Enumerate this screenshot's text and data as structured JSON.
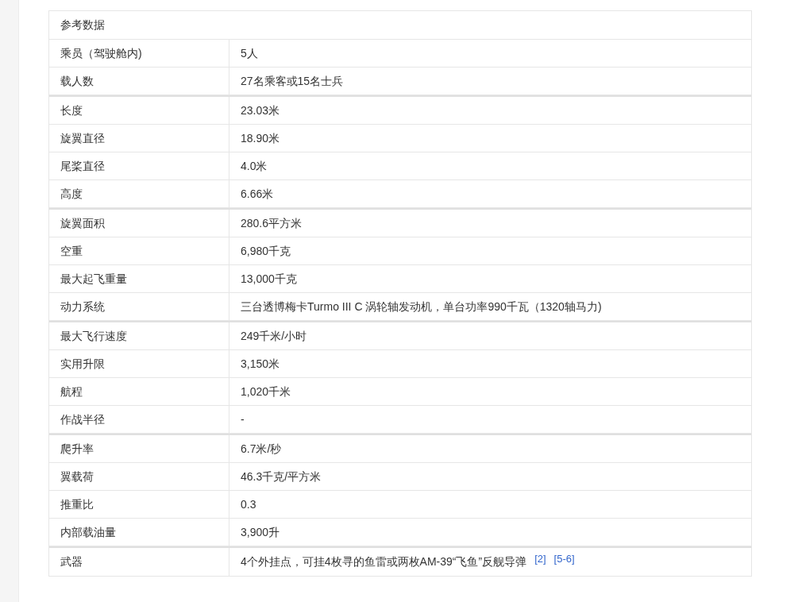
{
  "table": {
    "title": "参考数据",
    "rows": [
      {
        "label": "乘员（驾驶舱内)",
        "value": "5人",
        "section_start": false
      },
      {
        "label": "载人数",
        "value": "27名乘客或15名士兵",
        "section_start": false
      },
      {
        "label": "长度",
        "value": "23.03米",
        "section_start": true
      },
      {
        "label": "旋翼直径",
        "value": "18.90米",
        "section_start": false
      },
      {
        "label": "尾桨直径",
        "value": "4.0米",
        "section_start": false
      },
      {
        "label": "高度",
        "value": "6.66米",
        "section_start": false
      },
      {
        "label": "旋翼面积",
        "value": "280.6平方米",
        "section_start": true
      },
      {
        "label": "空重",
        "value": "6,980千克",
        "section_start": false
      },
      {
        "label": "最大起飞重量",
        "value": "13,000千克",
        "section_start": false
      },
      {
        "label": "动力系统",
        "value": "三台透博梅卡Turmo III C 涡轮轴发动机，单台功率990千瓦（1320轴马力)",
        "section_start": false
      },
      {
        "label": "最大飞行速度",
        "value": "249千米/小时",
        "section_start": true
      },
      {
        "label": "实用升限",
        "value": "3,150米",
        "section_start": false
      },
      {
        "label": "航程",
        "value": "1,020千米",
        "section_start": false
      },
      {
        "label": "作战半径",
        "value": "-",
        "section_start": false
      },
      {
        "label": "爬升率",
        "value": "6.7米/秒",
        "section_start": true
      },
      {
        "label": "翼载荷",
        "value": "46.3千克/平方米",
        "section_start": false
      },
      {
        "label": "推重比",
        "value": "0.3",
        "section_start": false
      },
      {
        "label": "内部载油量",
        "value": "3,900升",
        "section_start": false
      },
      {
        "label": "武器",
        "value": "4个外挂点，可挂4枚寻的鱼雷或两枚AM-39“飞鱼”反舰导弹",
        "section_start": true,
        "refs": [
          "[2]",
          "[5-6]"
        ]
      }
    ]
  }
}
